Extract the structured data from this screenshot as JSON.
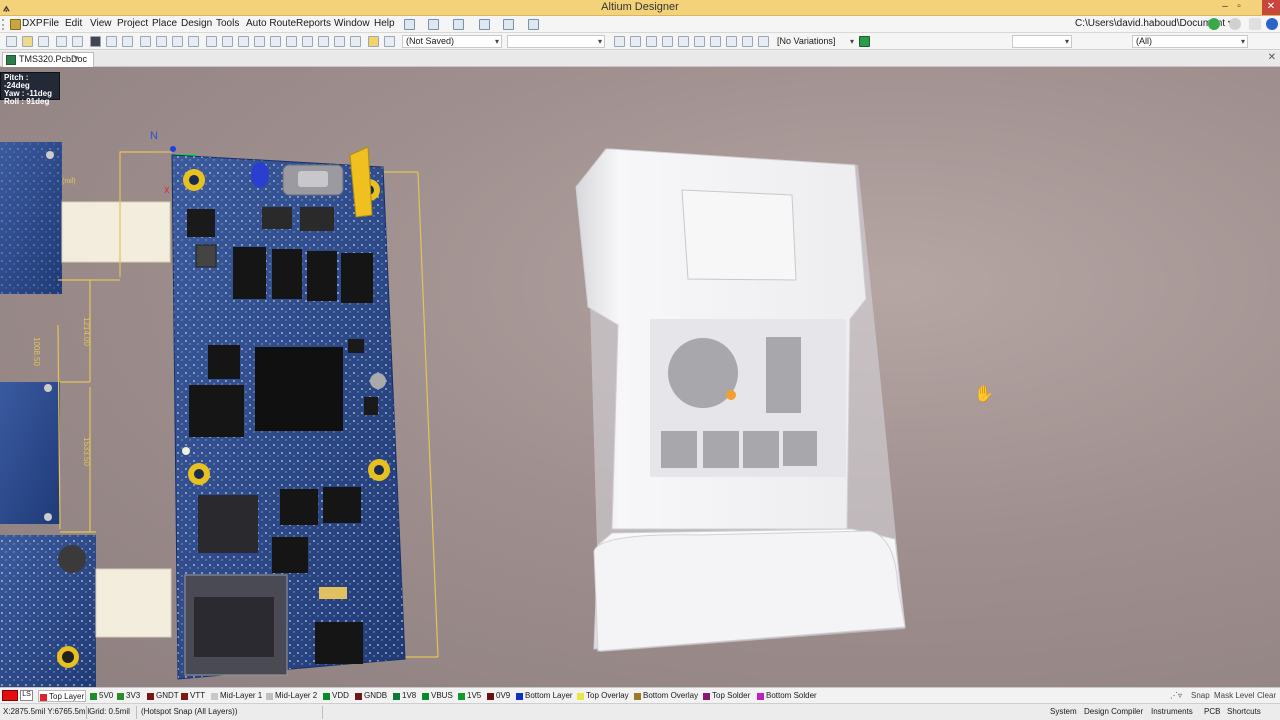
{
  "window": {
    "title": "Altium Designer"
  },
  "menu": {
    "items": [
      "DXP",
      "File",
      "Edit",
      "View",
      "Project",
      "Place",
      "Design",
      "Tools",
      "Auto Route",
      "Reports",
      "Window",
      "Help"
    ],
    "path": "C:\\Users\\david.haboud\\Document ▾"
  },
  "toolbar": {
    "save_state": "(Not Saved)",
    "blank_combo": "",
    "variations": "[No Variations]",
    "layer_filter": "(All)"
  },
  "document": {
    "tab_label": "TMS320.PcbDoc"
  },
  "view3d": {
    "pitch": "Pitch : -24deg",
    "yaw": "Yaw : -11deg",
    "roll": "Roll : 91deg",
    "dim_labels": [
      "1008.50",
      "1214.00",
      "1533.50",
      "(mil)"
    ]
  },
  "layers": [
    {
      "name": "Top Layer",
      "color": "#e0232b",
      "active": true
    },
    {
      "name": "5V0",
      "color": "#1e8c2a"
    },
    {
      "name": "3V3",
      "color": "#2c8c2c"
    },
    {
      "name": "GNDT",
      "color": "#7a1515"
    },
    {
      "name": "VTT",
      "color": "#7a1a10"
    },
    {
      "name": "Mid-Layer 1",
      "color": "#c8c8c8"
    },
    {
      "name": "Mid-Layer 2",
      "color": "#c0c0c0"
    },
    {
      "name": "VDD",
      "color": "#0a8a2a"
    },
    {
      "name": "GNDB",
      "color": "#6a1a1a"
    },
    {
      "name": "1V8",
      "color": "#0a7a3a"
    },
    {
      "name": "VBUS",
      "color": "#0a8a2a"
    },
    {
      "name": "1V5",
      "color": "#129a2a"
    },
    {
      "name": "0V9",
      "color": "#6a1010"
    },
    {
      "name": "Bottom Layer",
      "color": "#1030c8"
    },
    {
      "name": "Top Overlay",
      "color": "#e8e840"
    },
    {
      "name": "Bottom Overlay",
      "color": "#a07820"
    },
    {
      "name": "Top Solder",
      "color": "#8a1870"
    },
    {
      "name": "Bottom Solder",
      "color": "#c020c0"
    }
  ],
  "layerbar_right": {
    "snap": "Snap",
    "mask_level": "Mask Level",
    "clear": "Clear"
  },
  "status": {
    "coords": "X:2875.5mil Y:6765.5mil",
    "grid": "Grid: 0.5mil",
    "snap_mode": "(Hotspot Snap (All Layers))",
    "panels": [
      "System",
      "Design Compiler",
      "Instruments",
      "PCB",
      "Shortcuts"
    ]
  },
  "colors": {
    "titlebar": "#f3d27a",
    "viewport_bg": "#a09090",
    "pcb_blue": "#2a4a8c",
    "enclosure": "#f0f0f2"
  }
}
